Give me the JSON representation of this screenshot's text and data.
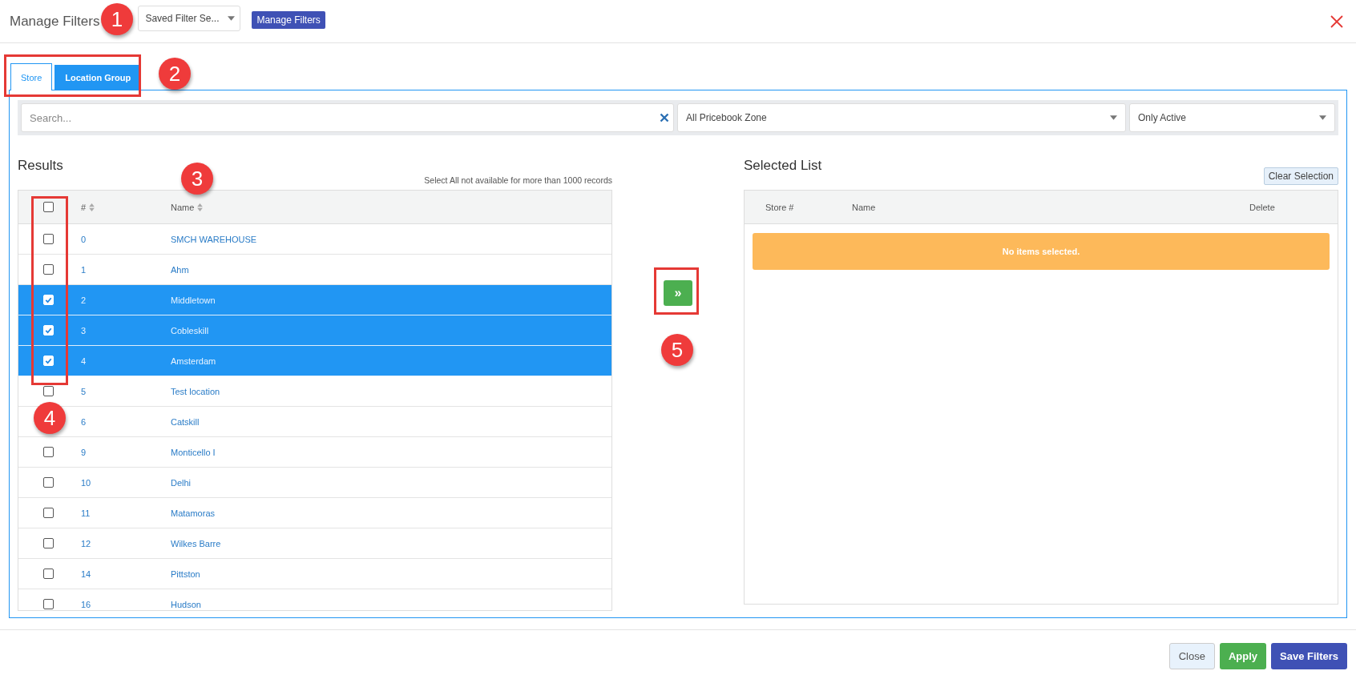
{
  "header": {
    "title": "Manage Filters",
    "saved_filter_select": {
      "value": "Saved Filter Se..."
    },
    "manage_button": "Manage Filters"
  },
  "tabs": [
    {
      "label": "Store",
      "selected": true
    },
    {
      "label": "Location Group",
      "selected": false
    }
  ],
  "filters": {
    "search": {
      "placeholder": "Search..."
    },
    "zone_select": {
      "value": "All Pricebook Zone"
    },
    "status_select": {
      "value": "Only Active"
    }
  },
  "results": {
    "title": "Results",
    "note": "Select All not available for more than 1000 records",
    "select_all_checked": false,
    "columns": [
      "#",
      "Name"
    ],
    "rows": [
      {
        "number": "0",
        "name": "SMCH WAREHOUSE",
        "selected": false,
        "checked": false
      },
      {
        "number": "1",
        "name": "Ahm",
        "selected": false,
        "checked": false
      },
      {
        "number": "2",
        "name": "Middletown",
        "selected": true,
        "checked": true
      },
      {
        "number": "3",
        "name": "Cobleskill",
        "selected": true,
        "checked": true
      },
      {
        "number": "4",
        "name": "Amsterdam",
        "selected": true,
        "checked": true
      },
      {
        "number": "5",
        "name": "Test location",
        "selected": false,
        "checked": false
      },
      {
        "number": "6",
        "name": "Catskill",
        "selected": false
      },
      {
        "number": "9",
        "name": "Monticello I",
        "selected": false,
        "checked": false
      },
      {
        "number": "10",
        "name": "Delhi",
        "selected": false,
        "checked": false
      },
      {
        "number": "11",
        "name": "Matamoras",
        "selected": false,
        "checked": false
      },
      {
        "number": "12",
        "name": "Wilkes Barre",
        "selected": false,
        "checked": false
      },
      {
        "number": "14",
        "name": "Pittston",
        "selected": false,
        "checked": false
      },
      {
        "number": "16",
        "name": "Hudson",
        "selected": false,
        "checked": false
      }
    ]
  },
  "move_button": "»",
  "selected_list": {
    "title": "Selected List",
    "clear_button": "Clear Selection",
    "columns": [
      "Store #",
      "Name",
      "Delete"
    ],
    "empty_message": "No items selected."
  },
  "footer_buttons": [
    {
      "label": "Close",
      "kind": "secondary"
    },
    {
      "label": "Apply",
      "kind": "success"
    },
    {
      "label": "Save Filters",
      "kind": "primary"
    }
  ],
  "annotations": [
    {
      "label": "1"
    },
    {
      "label": "2"
    },
    {
      "label": "3"
    },
    {
      "label": "4"
    },
    {
      "label": "5"
    }
  ]
}
